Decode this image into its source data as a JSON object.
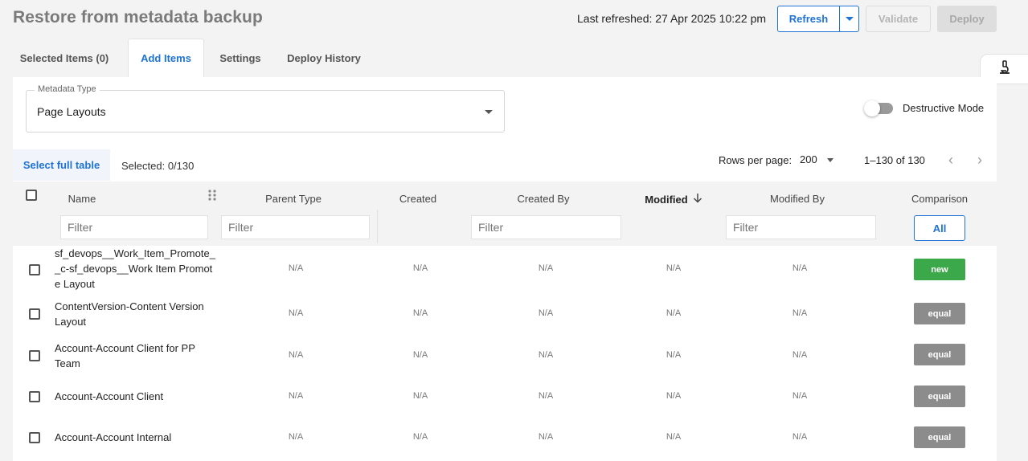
{
  "page": {
    "title": "Restore from metadata backup"
  },
  "header": {
    "last_refreshed": "Last refreshed: 27 Apr 2025 10:22 pm",
    "refresh_label": "Refresh",
    "validate_label": "Validate",
    "deploy_label": "Deploy"
  },
  "tabs": [
    {
      "label": "Selected Items (0)",
      "active": false
    },
    {
      "label": "Add Items",
      "active": true
    },
    {
      "label": "Settings",
      "active": false
    },
    {
      "label": "Deploy History",
      "active": false
    }
  ],
  "side_tab": {
    "icon": "microscope-icon"
  },
  "metadata": {
    "label": "Metadata Type",
    "value": "Page Layouts"
  },
  "destructive": {
    "label": "Destructive Mode",
    "enabled": false
  },
  "selection": {
    "select_full_label": "Select full table",
    "selected_text": "Selected: 0/130"
  },
  "pagination": {
    "rows_label": "Rows per page:",
    "rows_value": "200",
    "range": "1–130 of 130"
  },
  "table": {
    "columns": {
      "name": "Name",
      "parent_type": "Parent Type",
      "created": "Created",
      "created_by": "Created By",
      "modified": "Modified",
      "modified_by": "Modified By",
      "comparison": "Comparison"
    },
    "filter_placeholder": "Filter",
    "all_label": "All",
    "rows": [
      {
        "name": "sf_devops__Work_Item_Promote__c-sf_devops__Work Item Promote Layout",
        "parent_type": "N/A",
        "created": "N/A",
        "created_by": "N/A",
        "modified": "N/A",
        "modified_by": "N/A",
        "comparison": "new"
      },
      {
        "name": "ContentVersion-Content Version Layout",
        "parent_type": "N/A",
        "created": "N/A",
        "created_by": "N/A",
        "modified": "N/A",
        "modified_by": "N/A",
        "comparison": "equal"
      },
      {
        "name": "Account-Account Client for PP Team",
        "parent_type": "N/A",
        "created": "N/A",
        "created_by": "N/A",
        "modified": "N/A",
        "modified_by": "N/A",
        "comparison": "equal"
      },
      {
        "name": "Account-Account Client",
        "parent_type": "N/A",
        "created": "N/A",
        "created_by": "N/A",
        "modified": "N/A",
        "modified_by": "N/A",
        "comparison": "equal"
      },
      {
        "name": "Account-Account Internal",
        "parent_type": "N/A",
        "created": "N/A",
        "created_by": "N/A",
        "modified": "N/A",
        "modified_by": "N/A",
        "comparison": "equal"
      }
    ]
  },
  "colors": {
    "accent": "#1f73d6",
    "new_badge": "#3ba84a",
    "equal_badge": "#8c8c8c"
  }
}
